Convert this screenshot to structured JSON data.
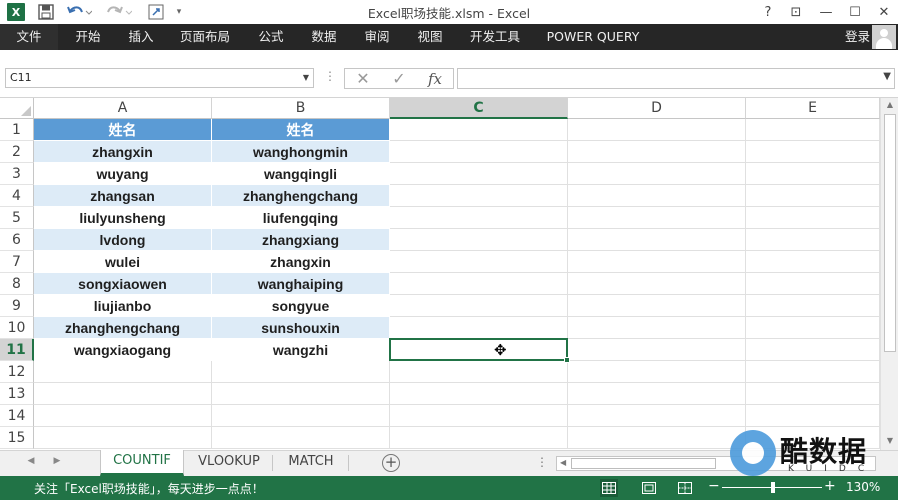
{
  "window": {
    "title": "Excel职场技能.xlsm - Excel",
    "help": "?",
    "ribbon_display": "⊡",
    "minimize": "—",
    "maximize": "☐",
    "close": "✕"
  },
  "qat": {
    "logo_text": "X"
  },
  "ribbon": {
    "tabs": [
      "文件",
      "开始",
      "插入",
      "页面布局",
      "公式",
      "数据",
      "审阅",
      "视图",
      "开发工具",
      "POWER QUERY"
    ],
    "login": "登录"
  },
  "formula_bar": {
    "name_box": "C11",
    "cancel": "✕",
    "enter": "✓",
    "fx": "fx",
    "formula": ""
  },
  "grid": {
    "columns": [
      "A",
      "B",
      "C",
      "D",
      "E"
    ],
    "selected_column": "C",
    "rows": [
      "1",
      "2",
      "3",
      "4",
      "5",
      "6",
      "7",
      "8",
      "9",
      "10",
      "11",
      "12",
      "13",
      "14",
      "15"
    ],
    "selected_row": "11",
    "table": {
      "header": [
        "姓名",
        "姓名"
      ],
      "body": [
        [
          "zhangxin",
          "wanghongmin"
        ],
        [
          "wuyang",
          "wangqingli"
        ],
        [
          "zhangsan",
          "zhanghengchang"
        ],
        [
          "liulyunsheng",
          "liufengqing"
        ],
        [
          "lvdong",
          "zhangxiang"
        ],
        [
          "wulei",
          "zhangxin"
        ],
        [
          "songxiaowen",
          "wanghaiping"
        ],
        [
          "liujianbo",
          "songyue"
        ],
        [
          "zhanghengchang",
          "sunshouxin"
        ],
        [
          "wangxiaogang",
          "wangzhi"
        ]
      ]
    },
    "colors": {
      "header": "#5b9bd5",
      "band": "#ddebf7",
      "accent": "#217346"
    }
  },
  "sheet_tabs": {
    "tabs": [
      "COUNTIF",
      "VLOOKUP",
      "MATCH"
    ],
    "active": "COUNTIF",
    "add": "+"
  },
  "status": {
    "message": "关注「Excel职场技能」，每天进步一点点！",
    "zoom": "130%",
    "zoom_minus": "−",
    "zoom_plus": "+"
  },
  "watermark": {
    "text": "酷数据",
    "sub": "KUIDC"
  }
}
